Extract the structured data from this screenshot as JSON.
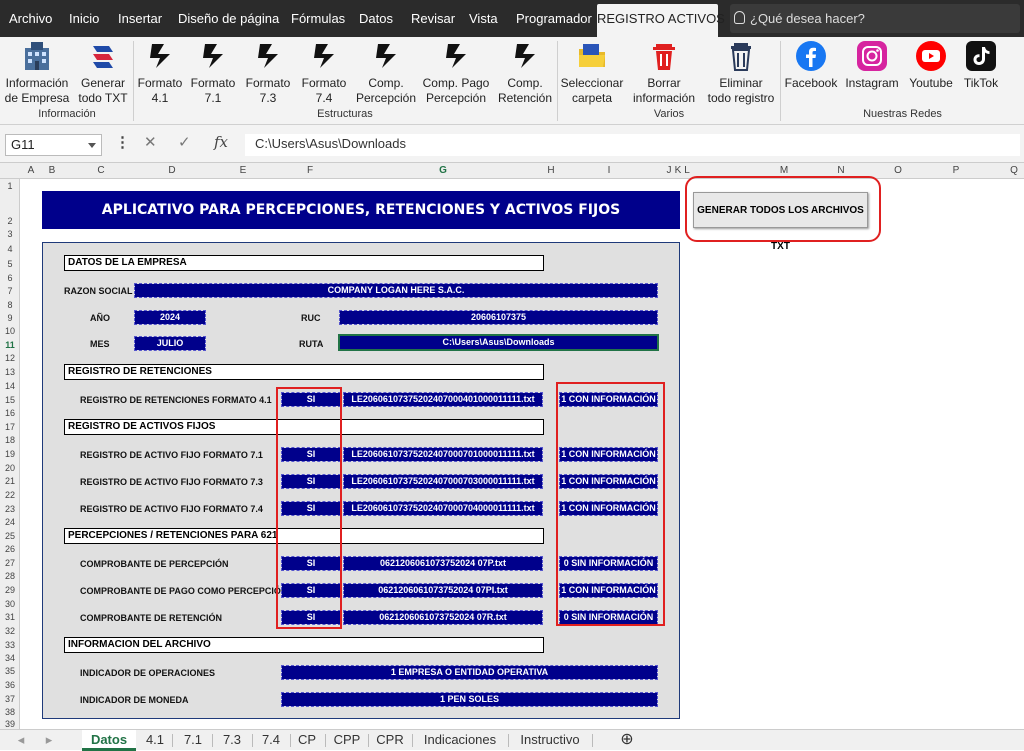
{
  "menu": {
    "tabs": [
      "Archivo",
      "Inicio",
      "Insertar",
      "Diseño de página",
      "Fórmulas",
      "Datos",
      "Revisar",
      "Vista",
      "Programador",
      "REGISTRO ACTIVOS"
    ],
    "search": "¿Qué desea hacer?"
  },
  "ribbon": {
    "buttons": [
      {
        "line1": "Información",
        "line2": "de Empresa",
        "icon": "building-icon"
      },
      {
        "line1": "Generar",
        "line2": "todo TXT",
        "icon": "generate-icon"
      },
      {
        "line1": "Formato",
        "line2": "4.1",
        "icon": "format-icon"
      },
      {
        "line1": "Formato",
        "line2": "7.1",
        "icon": "format-icon"
      },
      {
        "line1": "Formato",
        "line2": "7.3",
        "icon": "format-icon"
      },
      {
        "line1": "Formato",
        "line2": "7.4",
        "icon": "format-icon"
      },
      {
        "line1": "Comp.",
        "line2": "Percepción",
        "icon": "format-icon"
      },
      {
        "line1": "Comp. Pago",
        "line2": "Percepción",
        "icon": "format-icon"
      },
      {
        "line1": "Comp.",
        "line2": "Retención",
        "icon": "format-icon"
      },
      {
        "line1": "Seleccionar",
        "line2": "carpeta",
        "icon": "folder-icon"
      },
      {
        "line1": "Borrar",
        "line2": "información",
        "icon": "trash-icon"
      },
      {
        "line1": "Eliminar",
        "line2": "todo registro",
        "icon": "delete-all-icon"
      },
      {
        "line1": "Facebook",
        "line2": "",
        "icon": "facebook-icon"
      },
      {
        "line1": "Instagram",
        "line2": "",
        "icon": "instagram-icon"
      },
      {
        "line1": "Youtube",
        "line2": "",
        "icon": "youtube-icon"
      },
      {
        "line1": "TikTok",
        "line2": "",
        "icon": "tiktok-icon"
      }
    ],
    "groups": [
      "Información",
      "Estructuras",
      "Varios",
      "Nuestras Redes"
    ]
  },
  "formula_bar": {
    "name_box": "G11",
    "formula": "C:\\Users\\Asus\\Downloads"
  },
  "columns": [
    "A",
    "B",
    "C",
    "D",
    "E",
    "F",
    "G",
    "H",
    "I",
    "J",
    "K",
    "L",
    "M",
    "N",
    "O",
    "P",
    "Q"
  ],
  "rows": [
    "1",
    "2",
    "3",
    "4",
    "5",
    "6",
    "7",
    "8",
    "9",
    "10",
    "11",
    "12",
    "13",
    "14",
    "15",
    "16",
    "17",
    "18",
    "19",
    "20",
    "21",
    "22",
    "23",
    "24",
    "25",
    "26",
    "27",
    "28",
    "29",
    "30",
    "31",
    "32",
    "33",
    "34",
    "35",
    "36",
    "37",
    "38",
    "39"
  ],
  "sheet": {
    "banner": "APLICATIVO PARA PERCEPCIONES, RETENCIONES Y ACTIVOS FIJOS",
    "generate_button": "GENERAR TODOS LOS ARCHIVOS TXT",
    "empresa": {
      "header": "DATOS DE LA EMPRESA",
      "razon_label": "RAZON SOCIAL",
      "razon_value": "COMPANY LOGAN HERE S.A.C.",
      "anio_label": "AÑO",
      "anio_value": "2024",
      "ruc_label": "RUC",
      "ruc_value": "20606107375",
      "mes_label": "MES",
      "mes_value": "JULIO",
      "ruta_label": "RUTA",
      "ruta_value": "C:\\Users\\Asus\\Downloads"
    },
    "retenciones": {
      "header": "REGISTRO DE RETENCIONES",
      "rows": [
        {
          "label": "REGISTRO DE RETENCIONES FORMATO 4.1",
          "flag": "SI",
          "file": "LE20606107375202407000401000011111.txt",
          "status": "1 CON INFORMACIÓN"
        }
      ]
    },
    "activos": {
      "header": "REGISTRO DE ACTIVOS FIJOS",
      "rows": [
        {
          "label": "REGISTRO DE ACTIVO FIJO FORMATO 7.1",
          "flag": "SI",
          "file": "LE20606107375202407000701000011111.txt",
          "status": "1 CON INFORMACIÓN"
        },
        {
          "label": "REGISTRO DE ACTIVO FIJO FORMATO 7.3",
          "flag": "SI",
          "file": "LE20606107375202407000703000011111.txt",
          "status": "1 CON INFORMACIÓN"
        },
        {
          "label": "REGISTRO DE ACTIVO FIJO FORMATO 7.4",
          "flag": "SI",
          "file": "LE20606107375202407000704000011111.txt",
          "status": "1 CON INFORMACIÓN"
        }
      ]
    },
    "percepciones": {
      "header": "PERCEPCIONES / RETENCIONES PARA 621",
      "rows": [
        {
          "label": "COMPROBANTE DE PERCEPCIÓN",
          "flag": "SI",
          "file": "0621206061073752024 07P.txt",
          "status": "0 SIN INFORMACIÓN"
        },
        {
          "label": "COMPROBANTE DE PAGO COMO PERCEPCIÓN",
          "flag": "SI",
          "file": "0621206061073752024 07PI.txt",
          "status": "1 CON INFORMACIÓN"
        },
        {
          "label": "COMPROBANTE DE RETENCIÓN",
          "flag": "SI",
          "file": "0621206061073752024 07R.txt",
          "status": "0 SIN INFORMACIÓN"
        }
      ]
    },
    "archivo": {
      "header": "INFORMACION DEL ARCHIVO",
      "operaciones_label": "INDICADOR DE OPERACIONES",
      "operaciones_value": "1 EMPRESA O ENTIDAD OPERATIVA",
      "moneda_label": "INDICADOR DE MONEDA",
      "moneda_value": "1 PEN SOLES"
    }
  },
  "sheet_tabs": [
    "Datos",
    "4.1",
    "7.1",
    "7.3",
    "7.4",
    "CP",
    "CPP",
    "CPR",
    "Indicaciones",
    "Instructivo"
  ]
}
